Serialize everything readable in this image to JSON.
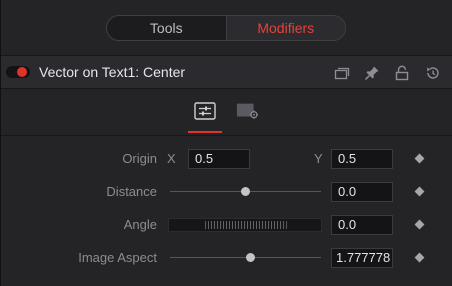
{
  "tabs": {
    "items": [
      {
        "label": "Tools",
        "active": false
      },
      {
        "label": "Modifiers",
        "active": true
      }
    ]
  },
  "header": {
    "enabled": true,
    "title": "Vector on Text1: Center",
    "icons": [
      "duplicate-icon",
      "pin-icon",
      "lock-icon",
      "reset-icon"
    ]
  },
  "subtabs": {
    "items": [
      "controls-icon",
      "settings-icon"
    ],
    "active_index": 0
  },
  "controls": {
    "origin": {
      "label": "Origin",
      "x_label": "X",
      "x_value": "0.5",
      "y_label": "Y",
      "y_value": "0.5"
    },
    "distance": {
      "label": "Distance",
      "value": "0.0",
      "slider_fraction": 0.5
    },
    "angle": {
      "label": "Angle",
      "value": "0.0"
    },
    "image_aspect": {
      "label": "Image Aspect",
      "value": "1.777778",
      "slider_fraction": 0.53
    }
  },
  "colors": {
    "accent": "#e0332b",
    "background": "#242427",
    "field": "#141416"
  }
}
